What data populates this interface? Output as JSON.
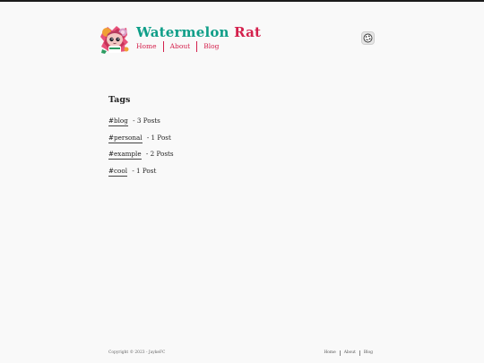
{
  "header": {
    "logo_icon": "rat-avatar-icon",
    "brand_word1": "Watermelon",
    "brand_word2": "Rat",
    "nav": [
      "Home",
      "About",
      "Blog"
    ],
    "theme_toggle_icon": "theme-toggle-icon"
  },
  "colors": {
    "accent_teal": "#0e9e88",
    "accent_red": "#d4204c",
    "background": "#f9f9f9"
  },
  "main": {
    "title": "Tags",
    "tags": [
      {
        "name": "#blog",
        "count": "- 3 Posts"
      },
      {
        "name": "#personal",
        "count": "- 1 Post"
      },
      {
        "name": "#example",
        "count": "- 2 Posts"
      },
      {
        "name": "#cool",
        "count": "- 1 Post"
      }
    ]
  },
  "footer": {
    "copyright": "Copyright © 2023 - JaykeFC",
    "nav": [
      "Home",
      "About",
      "Blog"
    ]
  }
}
